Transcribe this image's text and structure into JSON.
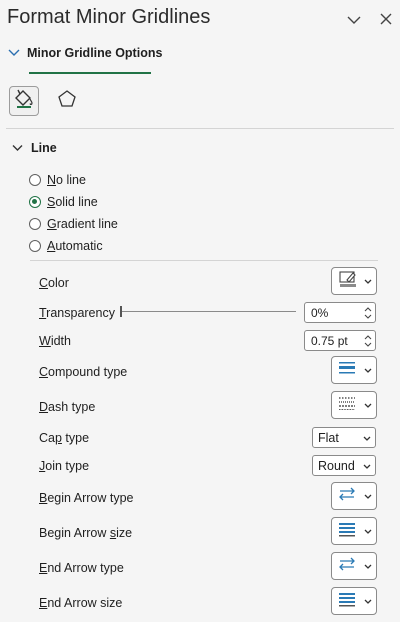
{
  "pane": {
    "title": "Format Minor Gridlines",
    "subtab_label": "Minor Gridline Options",
    "category_icons": [
      "paint-bucket-icon",
      "pentagon-icon"
    ],
    "accent_color": "#217346"
  },
  "line_section": {
    "title": "Line",
    "options": [
      {
        "key": "N",
        "rest": "o line",
        "selected": false
      },
      {
        "key": "S",
        "rest": "olid line",
        "selected": true
      },
      {
        "key": "G",
        "rest": "radient line",
        "selected": false
      },
      {
        "key": "A",
        "rest": "utomatic",
        "selected": false
      }
    ]
  },
  "properties": {
    "color": {
      "label_key": "C",
      "label_rest": "olor"
    },
    "transparency": {
      "label_key": "T",
      "label_rest": "ransparency",
      "value": "0%",
      "fraction": 0
    },
    "width": {
      "label_key": "W",
      "label_rest": "idth",
      "value": "0.75 pt"
    },
    "compound_type": {
      "label_key": "C",
      "label_rest": "ompound type"
    },
    "dash_type": {
      "label_key": "D",
      "label_rest": "ash type"
    },
    "cap_type": {
      "label_pre": "Ca",
      "label_key": "p",
      "label_rest": " type",
      "value": "Flat"
    },
    "join_type": {
      "label_key": "J",
      "label_rest": "oin type",
      "value": "Round"
    },
    "begin_arrow_type": {
      "label_key": "B",
      "label_rest": "egin Arrow type"
    },
    "begin_arrow_size": {
      "label_pre": "Begin Arrow ",
      "label_key": "s",
      "label_rest": "ize"
    },
    "end_arrow_type": {
      "label_key": "E",
      "label_rest": "nd Arrow type"
    },
    "end_arrow_size": {
      "label_key": "E",
      "label_rest": "nd Arrow size"
    }
  }
}
